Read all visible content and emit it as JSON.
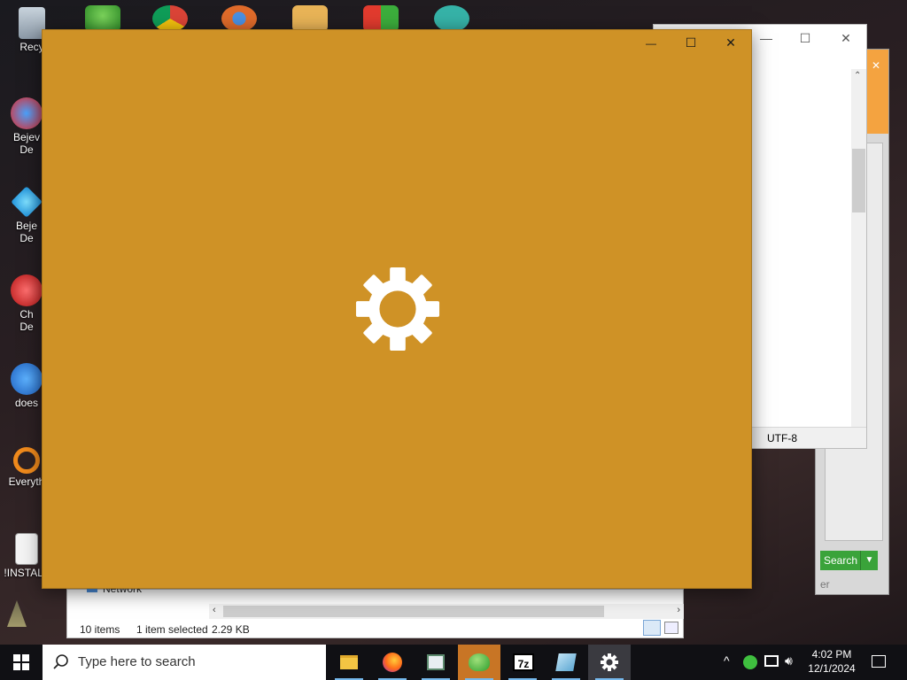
{
  "desktop": {
    "icons": [
      {
        "label": "Recy"
      },
      {
        "label": "Bejev"
      },
      {
        "label": "De"
      },
      {
        "label": "Beje"
      },
      {
        "label": "De"
      },
      {
        "label": "Ch"
      },
      {
        "label": "De"
      },
      {
        "label": "does"
      },
      {
        "label": "Everyth"
      },
      {
        "label": "!INSTALL"
      }
    ]
  },
  "notepad_window": {
    "minimize": "—",
    "maximize": "☐",
    "close": "✕",
    "encoding": "UTF-8"
  },
  "everything_window": {
    "search_button": "Search",
    "bottom_text": "er"
  },
  "explorer_window": {
    "nav_item": "Network",
    "item_count": "10 items",
    "selection": "1 item selected",
    "size": "2.29 KB"
  },
  "settings_window": {
    "minimize": "—",
    "maximize": "☐",
    "close": "✕",
    "accent": "#cf9226"
  },
  "taskbar": {
    "search_placeholder": "Type here to search",
    "time": "4:02 PM",
    "date": "12/1/2024",
    "apps": [
      {
        "name": "file-explorer"
      },
      {
        "name": "firefox"
      },
      {
        "name": "window-app"
      },
      {
        "name": "people-app"
      },
      {
        "name": "7zip",
        "label": "7z"
      },
      {
        "name": "notepad-app"
      },
      {
        "name": "settings"
      }
    ]
  }
}
